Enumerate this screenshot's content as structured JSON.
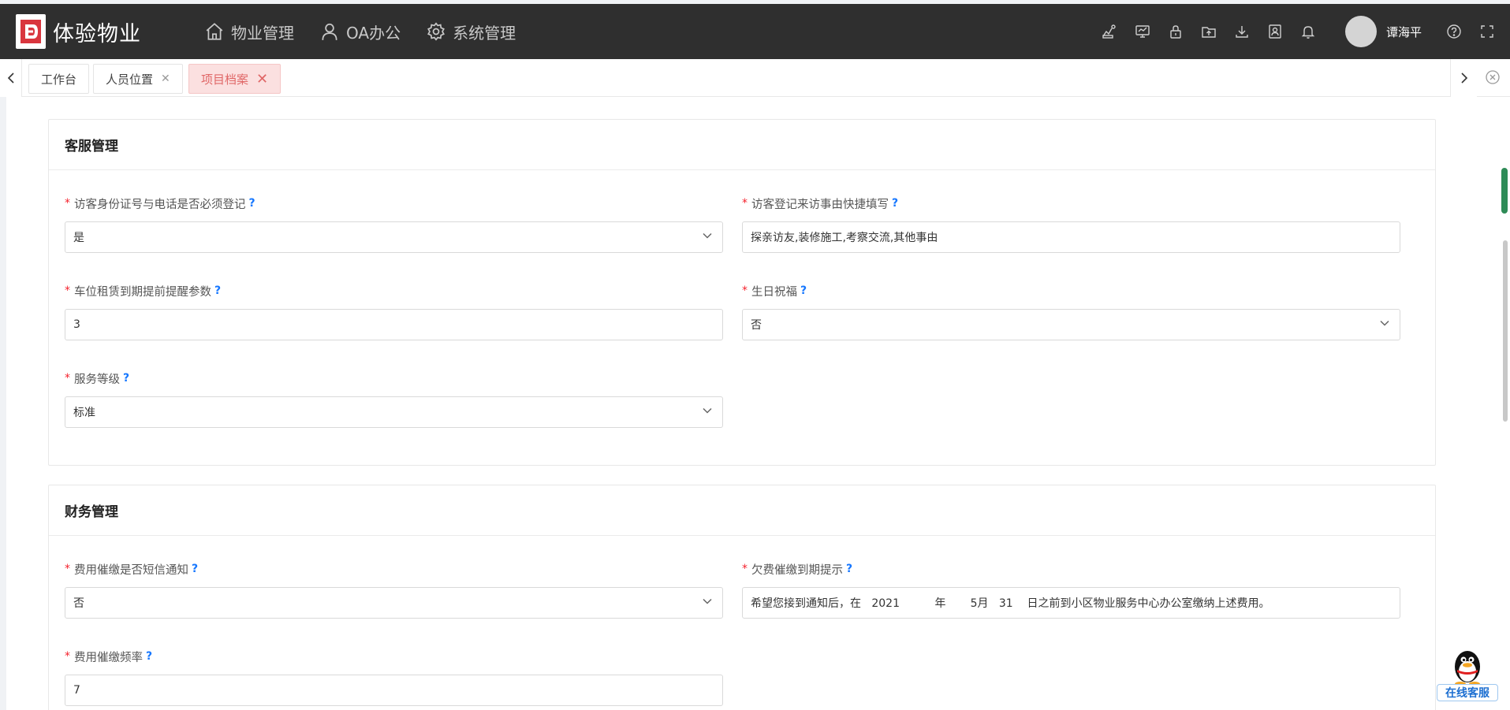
{
  "app": {
    "title": "体验物业",
    "brand_color": "#d9363e"
  },
  "nav": [
    {
      "label": "物业管理",
      "icon": "home-icon"
    },
    {
      "label": "OA办公",
      "icon": "user-icon"
    },
    {
      "label": "系统管理",
      "icon": "gear-icon"
    }
  ],
  "toolbar_icons": [
    "route-icon",
    "monitor-icon",
    "lock-icon",
    "upload-folder-icon",
    "download-icon",
    "contact-card-icon",
    "bell-icon"
  ],
  "user": {
    "name": "谭海平"
  },
  "tabs": [
    {
      "label": "工作台",
      "closable": false,
      "active": false
    },
    {
      "label": "人员位置",
      "closable": true,
      "active": false
    },
    {
      "label": "项目档案",
      "closable": true,
      "active": true
    }
  ],
  "sections": {
    "customer": {
      "title": "客服管理",
      "fields": {
        "id_phone_required": {
          "label": "访客身份证号与电话是否必须登记",
          "value": "是",
          "type": "select"
        },
        "visit_reason_quick": {
          "label": "访客登记来访事由快捷填写",
          "value": "探亲访友,装修施工,考察交流,其他事由",
          "type": "input"
        },
        "parking_reminder": {
          "label": "车位租赁到期提前提醒参数",
          "value": "3",
          "type": "input"
        },
        "birthday_greeting": {
          "label": "生日祝福",
          "value": "否",
          "type": "select"
        },
        "service_level": {
          "label": "服务等级",
          "value": "标准",
          "type": "select"
        }
      }
    },
    "finance": {
      "title": "财务管理",
      "fields": {
        "sms_notice": {
          "label": "费用催缴是否短信通知",
          "value": "否",
          "type": "select"
        },
        "arrears_due_notice": {
          "label": "欠费催缴到期提示",
          "value": "希望您接到通知后，在   2021          年       5月   31    日之前到小区物业服务中心办公室缴纳上述费用。",
          "type": "input"
        },
        "collect_frequency": {
          "label": "费用催缴频率",
          "value": "7",
          "type": "input"
        }
      }
    }
  },
  "help_mark": "?",
  "required_mark": "*",
  "online_service": {
    "label": "在线客服"
  }
}
